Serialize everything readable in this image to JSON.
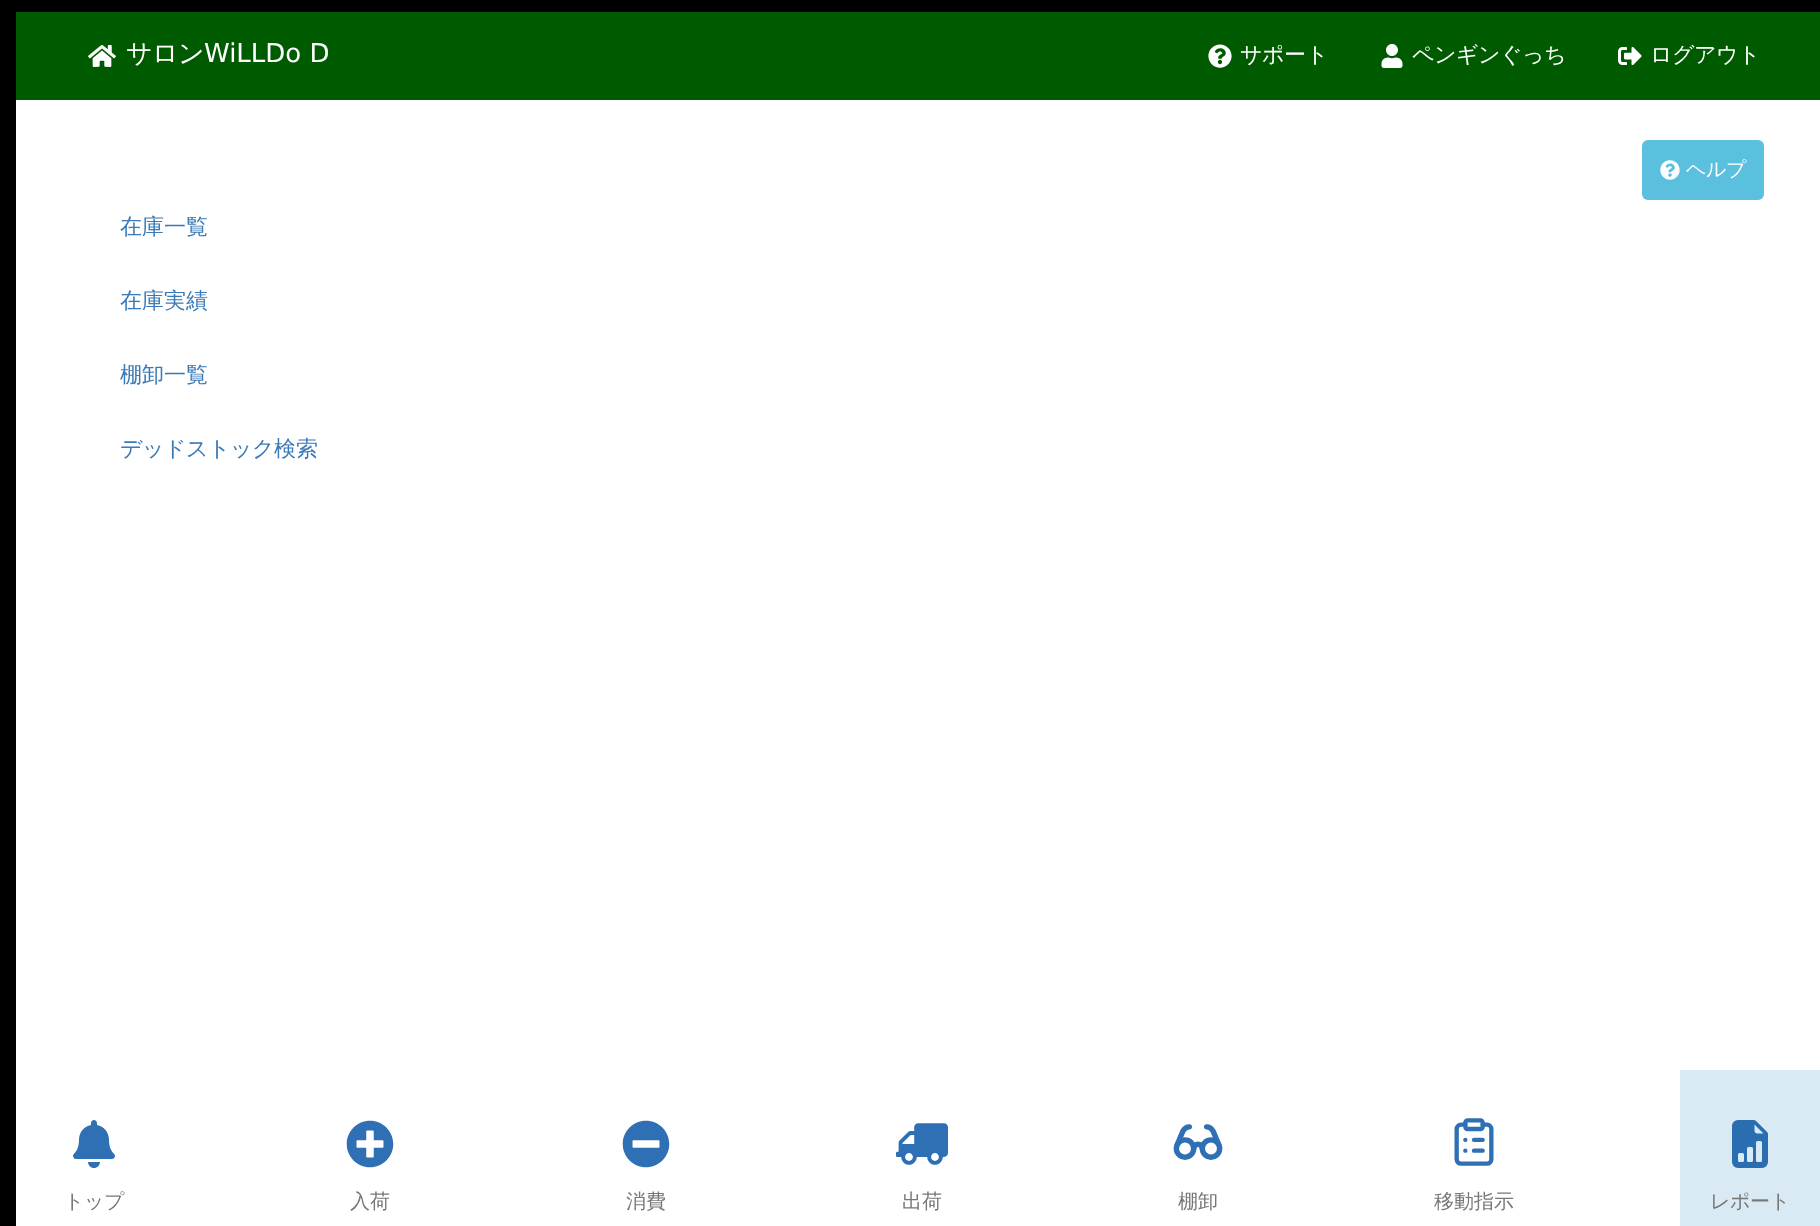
{
  "header": {
    "brand": "サロンWiLLDo D",
    "links": [
      {
        "kind": "support",
        "label": "サポート"
      },
      {
        "kind": "user",
        "label": "ペンギンぐっち"
      },
      {
        "kind": "logout",
        "label": "ログアウト"
      }
    ]
  },
  "help_button": {
    "label": "ヘルプ"
  },
  "menu": {
    "items": [
      {
        "label": "在庫一覧"
      },
      {
        "label": "在庫実績"
      },
      {
        "label": "棚卸一覧"
      },
      {
        "label": "デッドストック検索"
      }
    ]
  },
  "bottom_nav": {
    "items": [
      {
        "kind": "top",
        "label": "トップ",
        "selected": false
      },
      {
        "kind": "receive",
        "label": "入荷",
        "selected": false
      },
      {
        "kind": "consume",
        "label": "消費",
        "selected": false
      },
      {
        "kind": "ship",
        "label": "出荷",
        "selected": false
      },
      {
        "kind": "inventory",
        "label": "棚卸",
        "selected": false
      },
      {
        "kind": "move",
        "label": "移動指示",
        "selected": false
      },
      {
        "kind": "report",
        "label": "レポート",
        "selected": true
      }
    ]
  }
}
